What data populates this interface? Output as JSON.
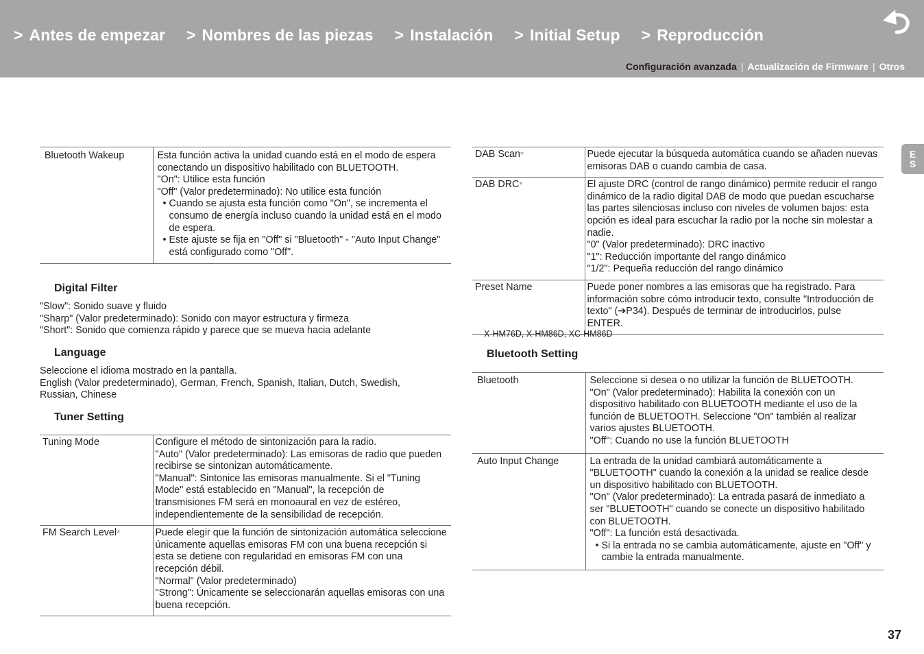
{
  "header": {
    "nav": [
      {
        "prefix": ">",
        "label": "Antes de empezar"
      },
      {
        "prefix": ">",
        "label": "Nombres de las piezas"
      },
      {
        "prefix": ">",
        "label": "Instalación"
      },
      {
        "prefix": ">",
        "label": "Initial Setup"
      },
      {
        "prefix": ">",
        "label": "Reproducción"
      }
    ],
    "back_icon": "return-arrow-icon",
    "subnav": {
      "active": "Configuración avanzada",
      "separator": "|",
      "items": [
        "Actualización de Firmware",
        "Otros"
      ]
    }
  },
  "lang_tab": {
    "line1": "E",
    "line2": "S"
  },
  "asterisk": "*",
  "left": {
    "wakeup_table": {
      "rows": [
        {
          "key": "Bluetooth Wakeup",
          "lines": [
            "Esta función activa la unidad cuando está en el modo de espera conectando un dispositivo habilitado con BLUETOOTH.",
            "\"On\": Utilice esta función",
            "\"Off\" (Valor predeterminado): No utilice esta función"
          ],
          "bullets": [
            "Cuando se ajusta esta función como \"On\", se incrementa el consumo de energía incluso cuando la unidad está en el modo de espera.",
            "Este ajuste se fija en \"Off\" si \"Bluetooth\" - \"Auto Input Change\" está configurado como \"Off\"."
          ]
        }
      ]
    },
    "digital_filter": {
      "title": "Digital Filter",
      "lines": [
        "\"Slow\": Sonido suave y fluido",
        "\"Sharp\" (Valor predeterminado): Sonido con mayor estructura y firmeza",
        "\"Short\": Sonido que comienza rápido y parece que se mueva hacia adelante"
      ]
    },
    "language": {
      "title": "Language",
      "lines": [
        "Seleccione el idioma mostrado en la pantalla.",
        "English (Valor predeterminado), German, French, Spanish, Italian, Dutch, Swedish,",
        "Russian, Chinese"
      ]
    },
    "tuner_setting": {
      "title": "Tuner Setting",
      "rows": [
        {
          "key": "Tuning Mode",
          "asterisk": false,
          "lines": [
            "Configure el método de sintonización para la radio.",
            "\"Auto\" (Valor predeterminado): Las emisoras de radio que pueden recibirse se sintonizan automáticamente.",
            "\"Manual\": Sintonice las emisoras manualmente. Si el \"Tuning Mode\" está establecido en \"Manual\", la recepción de transmisiones FM será en monoaural en vez de estéreo, independientemente de la sensibilidad de recepción."
          ]
        },
        {
          "key": "FM Search Level",
          "asterisk": true,
          "lines": [
            "Puede elegir que la función de sintonización automática seleccione únicamente aquellas emisoras FM con una buena recepción si esta se detiene con regularidad en emisoras FM con una recepción débil.",
            "\"Normal\" (Valor predeterminado)",
            "\"Strong\": Únicamente se seleccionarán aquellas emisoras con una buena recepción."
          ]
        }
      ]
    }
  },
  "right": {
    "dab_table": {
      "rows": [
        {
          "key": "DAB Scan",
          "asterisk": true,
          "lines": [
            "Puede ejecutar la búsqueda automática cuando se añaden nuevas emisoras DAB o cuando cambia de casa."
          ]
        },
        {
          "key": "DAB DRC",
          "asterisk": true,
          "lines": [
            "El ajuste DRC (control de rango dinámico) permite reducir el rango dinámico de la radio digital DAB de modo que puedan escucharse las partes silenciosas incluso con niveles de volumen bajos: esta opción es ideal para escuchar la radio por la noche sin molestar a nadie.",
            "\"0\" (Valor predeterminado): DRC inactivo",
            "\"1\": Reducción importante del rango dinámico",
            "\"1/2\": Pequeña reducción del rango dinámico"
          ]
        },
        {
          "key": "Preset Name",
          "asterisk": false,
          "lines": [
            "Puede poner nombres a las emisoras que ha registrado. Para información sobre cómo introducir texto, consulte \"Introducción de texto\" (➔P34). Después de terminar de introducirlos, pulse ENTER."
          ]
        }
      ]
    },
    "footnote": "X-HM76D, X-HM86D, XC-HM86D",
    "bluetooth_setting": {
      "title": "Bluetooth Setting",
      "rows": [
        {
          "key": "Bluetooth",
          "lines": [
            "Seleccione si desea o no utilizar la función de BLUETOOTH.",
            "\"On\" (Valor predeterminado): Habilita la conexión con un dispositivo habilitado con BLUETOOTH mediante el uso de la función de BLUETOOTH. Seleccione \"On\" también al realizar varios ajustes BLUETOOTH.",
            "\"Off\": Cuando no use la función BLUETOOTH"
          ],
          "bullets": []
        },
        {
          "key": "Auto Input Change",
          "lines": [
            "La entrada de la unidad cambiará automáticamente a \"BLUETOOTH\" cuando la conexión a la unidad se realice desde un dispositivo habilitado con BLUETOOTH.",
            "\"On\" (Valor predeterminado): La entrada pasará de inmediato a ser \"BLUETOOTH\" cuando se conecte un dispositivo habilitado con BLUETOOTH.",
            "\"Off\": La función está desactivada."
          ],
          "bullets": [
            "Si la entrada no se cambia automáticamente, ajuste en \"Off\" y cambie la entrada manualmente."
          ]
        }
      ]
    }
  },
  "page_number": "37"
}
